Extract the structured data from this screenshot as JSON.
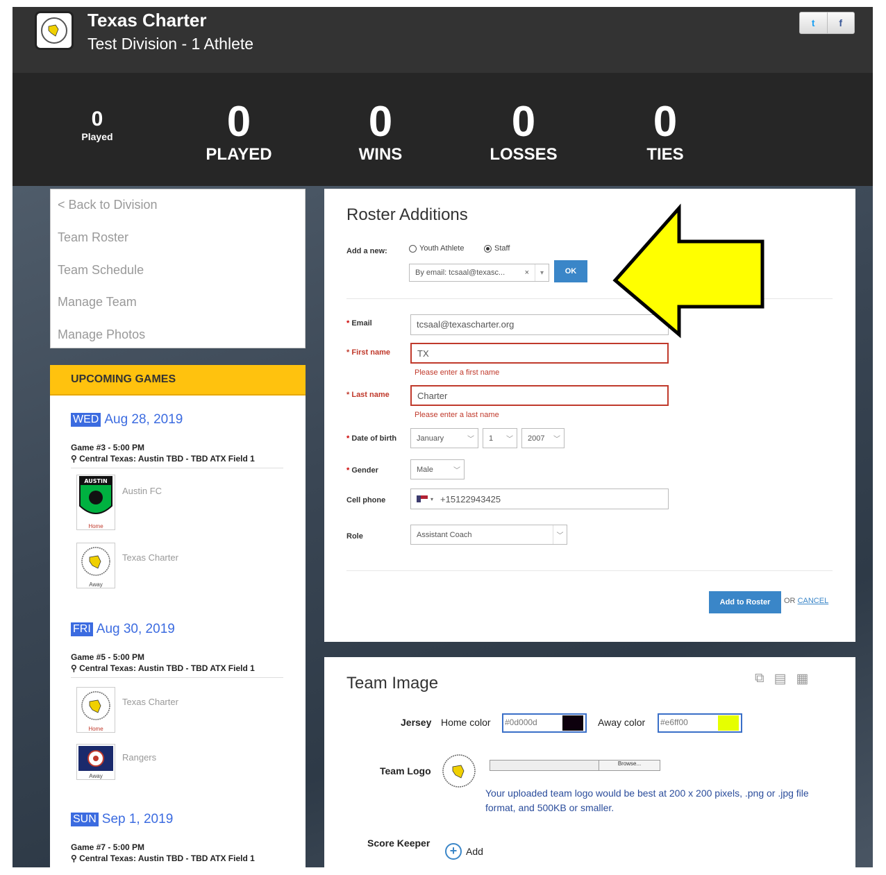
{
  "header": {
    "team_name": "Texas Charter",
    "division": "Test Division - 1 Athlete",
    "social": {
      "twitter": "t",
      "facebook": "f"
    }
  },
  "stats": {
    "small": {
      "value": "0",
      "label": "Played"
    },
    "items": [
      {
        "value": "0",
        "label": "PLAYED"
      },
      {
        "value": "0",
        "label": "WINS"
      },
      {
        "value": "0",
        "label": "LOSSES"
      },
      {
        "value": "0",
        "label": "TIES"
      }
    ]
  },
  "nav": {
    "items": [
      "< Back to Division",
      "Team Roster",
      "Team Schedule",
      "Manage Team",
      "Manage Photos"
    ]
  },
  "upcoming": {
    "title": "UPCOMING GAMES",
    "games": [
      {
        "day": "WED",
        "date": "Aug 28, 2019",
        "title": "Game #3 - 5:00 PM",
        "location": "Central Texas: Austin TBD - TBD ATX Field 1",
        "home": "Austin FC",
        "away": "Texas Charter",
        "home_tag": "Home",
        "away_tag": "Away",
        "badge_text": "AUSTIN"
      },
      {
        "day": "FRI",
        "date": "Aug 30, 2019",
        "title": "Game #5 - 5:00 PM",
        "location": "Central Texas: Austin TBD - TBD ATX Field 1",
        "home": "Texas Charter",
        "away": "Rangers",
        "home_tag": "Home",
        "away_tag": "Away"
      },
      {
        "day": "SUN",
        "date": "Sep 1, 2019",
        "title": "Game #7 - 5:00 PM",
        "location": "Central Texas: Austin TBD - TBD ATX Field 1"
      }
    ]
  },
  "roster": {
    "title": "Roster Additions",
    "add_new_label": "Add a new:",
    "radio_youth": "Youth Athlete",
    "radio_staff": "Staff",
    "staff_selected": true,
    "lookup_value": "By email: tcsaal@texasc...",
    "lookup_clear": "×",
    "ok_label": "OK",
    "fields": {
      "email": {
        "label": "Email",
        "value": "tcsaal@texascharter.org"
      },
      "first_name": {
        "label": "First name",
        "value": "TX",
        "error": "Please enter a first name"
      },
      "last_name": {
        "label": "Last name",
        "value": "Charter",
        "error": "Please enter a last name"
      },
      "dob": {
        "label": "Date of birth",
        "month": "January",
        "day": "1",
        "year": "2007"
      },
      "gender": {
        "label": "Gender",
        "value": "Male"
      },
      "cell": {
        "label": "Cell phone",
        "value": "+15122943425"
      },
      "role": {
        "label": "Role",
        "value": "Assistant Coach"
      }
    },
    "add_button": "Add to Roster",
    "or_text": "OR",
    "cancel": "CANCEL"
  },
  "team_image": {
    "title": "Team Image",
    "jersey_label": "Jersey",
    "home_color_label": "Home color",
    "home_color_value": "#0d000d",
    "away_color_label": "Away color",
    "away_color_value": "#e6ff00",
    "team_logo_label": "Team Logo",
    "browse_label": "Browse...",
    "hint": "Your uploaded team logo would be best at 200 x 200 pixels, .png or .jpg file format, and 500KB or smaller.",
    "score_keeper_label": "Score Keeper",
    "add_label": "Add"
  },
  "colors": {
    "accent_blue": "#3a86c8",
    "upcoming_yellow": "#ffc20e",
    "error_red": "#c0392b",
    "arrow_yellow": "#ffff00"
  }
}
